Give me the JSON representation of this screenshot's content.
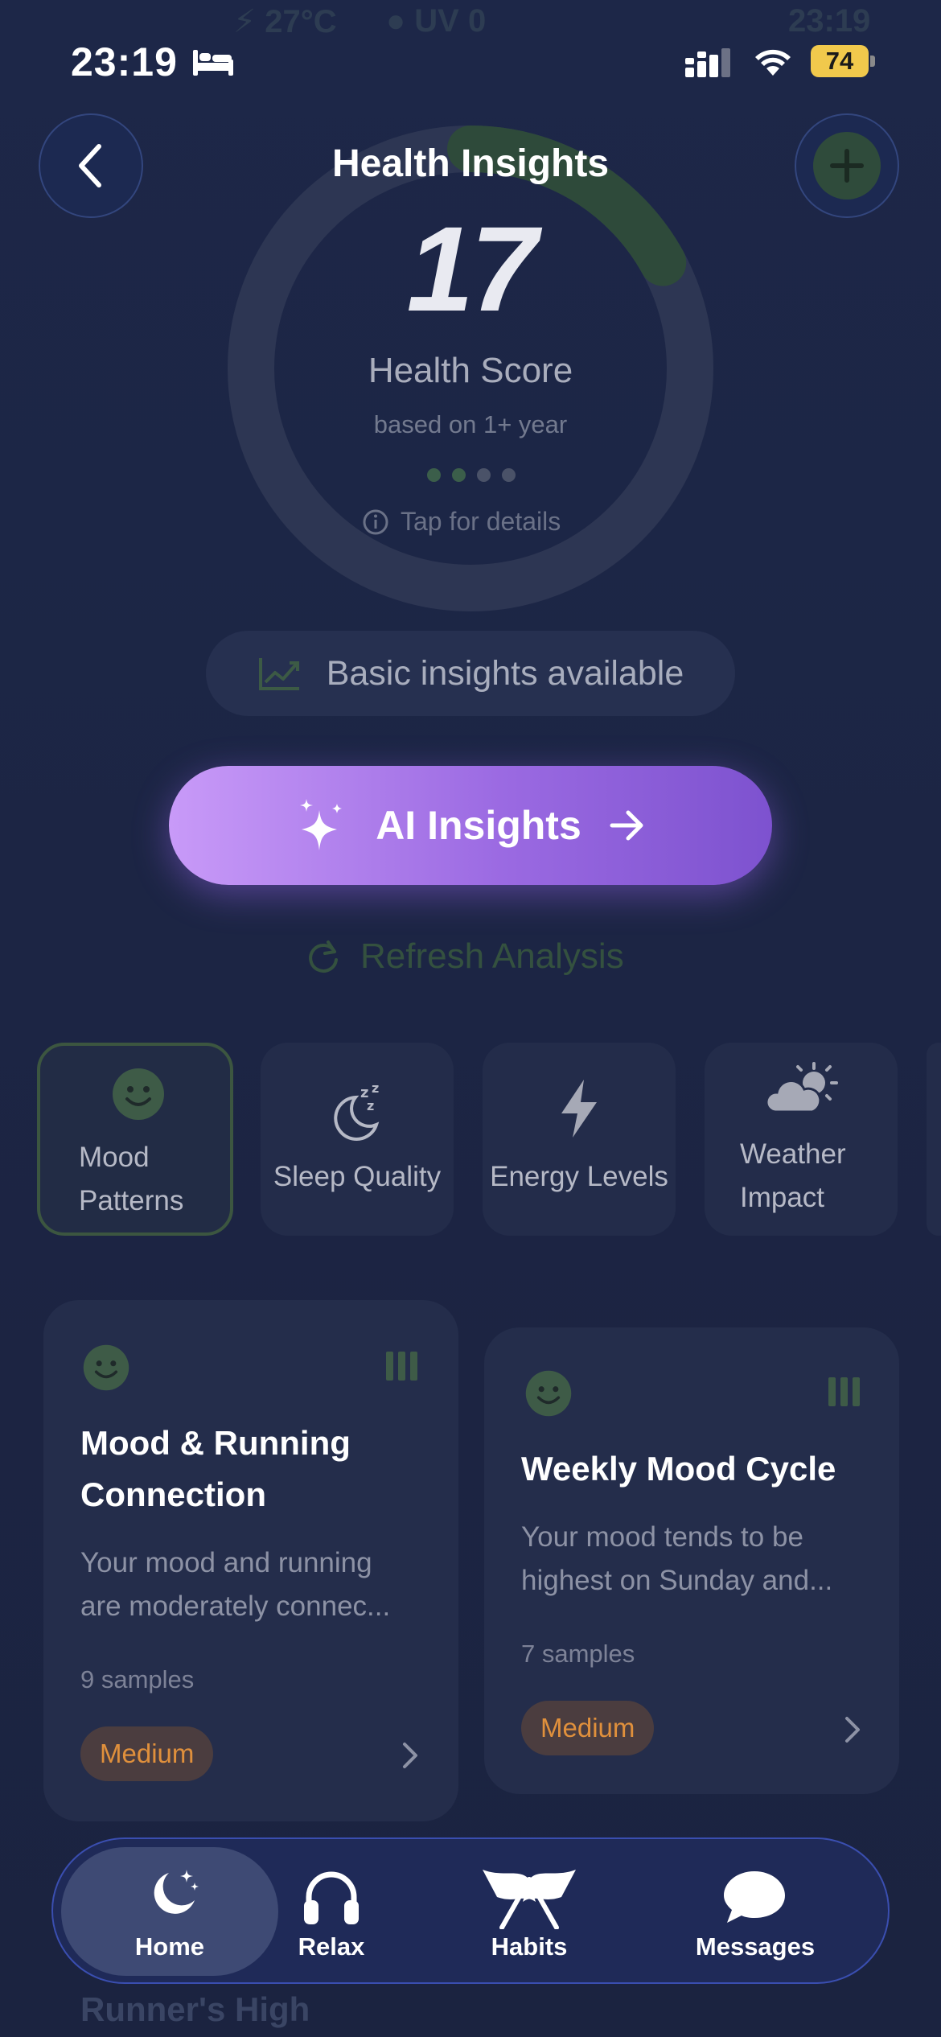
{
  "status_bar": {
    "time": "23:19",
    "battery": "74",
    "ghost_left": "⚡ 27°C",
    "ghost_mid": "● UV 0",
    "ghost_right": "23:19"
  },
  "header": {
    "title": "Health Insights"
  },
  "score": {
    "value": "17",
    "label": "Health Score",
    "sub": "based on 1+ year",
    "tap": "Tap for details",
    "progress": 0.17
  },
  "basic_insights": "Basic insights available",
  "ai_button": "AI Insights",
  "refresh": "Refresh Analysis",
  "categories": [
    {
      "label_line1": "Mood",
      "label_line2": "Patterns",
      "icon": "smiley-icon",
      "selected": true
    },
    {
      "label": "Sleep Quality",
      "icon": "moon-zzz-icon"
    },
    {
      "label": "Energy Levels",
      "icon": "lightning-icon"
    },
    {
      "label_line1": "Weather",
      "label_line2": "Impact",
      "icon": "sun-cloud-icon"
    }
  ],
  "cards": [
    {
      "title_line1": "Mood & Running",
      "title_line2": "Connection",
      "desc_line1": "Your mood and running",
      "desc_line2": "are moderately connec...",
      "samples": "9 samples",
      "badge": "Medium"
    },
    {
      "title": "Weekly Mood Cycle",
      "desc_line1": "Your mood tends to be",
      "desc_line2": "highest on Sunday and...",
      "samples": "7 samples",
      "badge": "Medium"
    }
  ],
  "nav": [
    {
      "label": "Home",
      "icon": "moon-stars-icon",
      "active": true
    },
    {
      "label": "Relax",
      "icon": "headphones-icon"
    },
    {
      "label": "Habits",
      "icon": "flags-icon"
    },
    {
      "label": "Messages",
      "icon": "chat-bubble-icon"
    }
  ],
  "next_card_title": "Runner's High",
  "colors": {
    "accent_green": "#3b5e4a",
    "ai_gradient_start": "#c89af8",
    "ai_gradient_end": "#7d52cf",
    "badge_text": "#e0903c"
  }
}
